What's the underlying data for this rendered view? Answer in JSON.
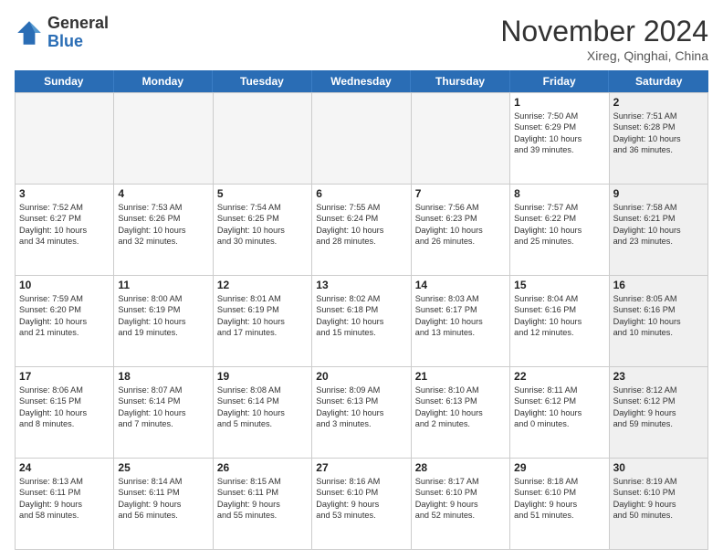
{
  "logo": {
    "general": "General",
    "blue": "Blue"
  },
  "title": "November 2024",
  "location": "Xireg, Qinghai, China",
  "weekdays": [
    "Sunday",
    "Monday",
    "Tuesday",
    "Wednesday",
    "Thursday",
    "Friday",
    "Saturday"
  ],
  "weeks": [
    [
      {
        "day": "",
        "lines": [],
        "empty": true
      },
      {
        "day": "",
        "lines": [],
        "empty": true
      },
      {
        "day": "",
        "lines": [],
        "empty": true
      },
      {
        "day": "",
        "lines": [],
        "empty": true
      },
      {
        "day": "",
        "lines": [],
        "empty": true
      },
      {
        "day": "1",
        "lines": [
          "Sunrise: 7:50 AM",
          "Sunset: 6:29 PM",
          "Daylight: 10 hours",
          "and 39 minutes."
        ],
        "empty": false,
        "shaded": false
      },
      {
        "day": "2",
        "lines": [
          "Sunrise: 7:51 AM",
          "Sunset: 6:28 PM",
          "Daylight: 10 hours",
          "and 36 minutes."
        ],
        "empty": false,
        "shaded": true
      }
    ],
    [
      {
        "day": "3",
        "lines": [
          "Sunrise: 7:52 AM",
          "Sunset: 6:27 PM",
          "Daylight: 10 hours",
          "and 34 minutes."
        ],
        "empty": false,
        "shaded": false
      },
      {
        "day": "4",
        "lines": [
          "Sunrise: 7:53 AM",
          "Sunset: 6:26 PM",
          "Daylight: 10 hours",
          "and 32 minutes."
        ],
        "empty": false,
        "shaded": false
      },
      {
        "day": "5",
        "lines": [
          "Sunrise: 7:54 AM",
          "Sunset: 6:25 PM",
          "Daylight: 10 hours",
          "and 30 minutes."
        ],
        "empty": false,
        "shaded": false
      },
      {
        "day": "6",
        "lines": [
          "Sunrise: 7:55 AM",
          "Sunset: 6:24 PM",
          "Daylight: 10 hours",
          "and 28 minutes."
        ],
        "empty": false,
        "shaded": false
      },
      {
        "day": "7",
        "lines": [
          "Sunrise: 7:56 AM",
          "Sunset: 6:23 PM",
          "Daylight: 10 hours",
          "and 26 minutes."
        ],
        "empty": false,
        "shaded": false
      },
      {
        "day": "8",
        "lines": [
          "Sunrise: 7:57 AM",
          "Sunset: 6:22 PM",
          "Daylight: 10 hours",
          "and 25 minutes."
        ],
        "empty": false,
        "shaded": false
      },
      {
        "day": "9",
        "lines": [
          "Sunrise: 7:58 AM",
          "Sunset: 6:21 PM",
          "Daylight: 10 hours",
          "and 23 minutes."
        ],
        "empty": false,
        "shaded": true
      }
    ],
    [
      {
        "day": "10",
        "lines": [
          "Sunrise: 7:59 AM",
          "Sunset: 6:20 PM",
          "Daylight: 10 hours",
          "and 21 minutes."
        ],
        "empty": false,
        "shaded": false
      },
      {
        "day": "11",
        "lines": [
          "Sunrise: 8:00 AM",
          "Sunset: 6:19 PM",
          "Daylight: 10 hours",
          "and 19 minutes."
        ],
        "empty": false,
        "shaded": false
      },
      {
        "day": "12",
        "lines": [
          "Sunrise: 8:01 AM",
          "Sunset: 6:19 PM",
          "Daylight: 10 hours",
          "and 17 minutes."
        ],
        "empty": false,
        "shaded": false
      },
      {
        "day": "13",
        "lines": [
          "Sunrise: 8:02 AM",
          "Sunset: 6:18 PM",
          "Daylight: 10 hours",
          "and 15 minutes."
        ],
        "empty": false,
        "shaded": false
      },
      {
        "day": "14",
        "lines": [
          "Sunrise: 8:03 AM",
          "Sunset: 6:17 PM",
          "Daylight: 10 hours",
          "and 13 minutes."
        ],
        "empty": false,
        "shaded": false
      },
      {
        "day": "15",
        "lines": [
          "Sunrise: 8:04 AM",
          "Sunset: 6:16 PM",
          "Daylight: 10 hours",
          "and 12 minutes."
        ],
        "empty": false,
        "shaded": false
      },
      {
        "day": "16",
        "lines": [
          "Sunrise: 8:05 AM",
          "Sunset: 6:16 PM",
          "Daylight: 10 hours",
          "and 10 minutes."
        ],
        "empty": false,
        "shaded": true
      }
    ],
    [
      {
        "day": "17",
        "lines": [
          "Sunrise: 8:06 AM",
          "Sunset: 6:15 PM",
          "Daylight: 10 hours",
          "and 8 minutes."
        ],
        "empty": false,
        "shaded": false
      },
      {
        "day": "18",
        "lines": [
          "Sunrise: 8:07 AM",
          "Sunset: 6:14 PM",
          "Daylight: 10 hours",
          "and 7 minutes."
        ],
        "empty": false,
        "shaded": false
      },
      {
        "day": "19",
        "lines": [
          "Sunrise: 8:08 AM",
          "Sunset: 6:14 PM",
          "Daylight: 10 hours",
          "and 5 minutes."
        ],
        "empty": false,
        "shaded": false
      },
      {
        "day": "20",
        "lines": [
          "Sunrise: 8:09 AM",
          "Sunset: 6:13 PM",
          "Daylight: 10 hours",
          "and 3 minutes."
        ],
        "empty": false,
        "shaded": false
      },
      {
        "day": "21",
        "lines": [
          "Sunrise: 8:10 AM",
          "Sunset: 6:13 PM",
          "Daylight: 10 hours",
          "and 2 minutes."
        ],
        "empty": false,
        "shaded": false
      },
      {
        "day": "22",
        "lines": [
          "Sunrise: 8:11 AM",
          "Sunset: 6:12 PM",
          "Daylight: 10 hours",
          "and 0 minutes."
        ],
        "empty": false,
        "shaded": false
      },
      {
        "day": "23",
        "lines": [
          "Sunrise: 8:12 AM",
          "Sunset: 6:12 PM",
          "Daylight: 9 hours",
          "and 59 minutes."
        ],
        "empty": false,
        "shaded": true
      }
    ],
    [
      {
        "day": "24",
        "lines": [
          "Sunrise: 8:13 AM",
          "Sunset: 6:11 PM",
          "Daylight: 9 hours",
          "and 58 minutes."
        ],
        "empty": false,
        "shaded": false
      },
      {
        "day": "25",
        "lines": [
          "Sunrise: 8:14 AM",
          "Sunset: 6:11 PM",
          "Daylight: 9 hours",
          "and 56 minutes."
        ],
        "empty": false,
        "shaded": false
      },
      {
        "day": "26",
        "lines": [
          "Sunrise: 8:15 AM",
          "Sunset: 6:11 PM",
          "Daylight: 9 hours",
          "and 55 minutes."
        ],
        "empty": false,
        "shaded": false
      },
      {
        "day": "27",
        "lines": [
          "Sunrise: 8:16 AM",
          "Sunset: 6:10 PM",
          "Daylight: 9 hours",
          "and 53 minutes."
        ],
        "empty": false,
        "shaded": false
      },
      {
        "day": "28",
        "lines": [
          "Sunrise: 8:17 AM",
          "Sunset: 6:10 PM",
          "Daylight: 9 hours",
          "and 52 minutes."
        ],
        "empty": false,
        "shaded": false
      },
      {
        "day": "29",
        "lines": [
          "Sunrise: 8:18 AM",
          "Sunset: 6:10 PM",
          "Daylight: 9 hours",
          "and 51 minutes."
        ],
        "empty": false,
        "shaded": false
      },
      {
        "day": "30",
        "lines": [
          "Sunrise: 8:19 AM",
          "Sunset: 6:10 PM",
          "Daylight: 9 hours",
          "and 50 minutes."
        ],
        "empty": false,
        "shaded": true
      }
    ]
  ]
}
